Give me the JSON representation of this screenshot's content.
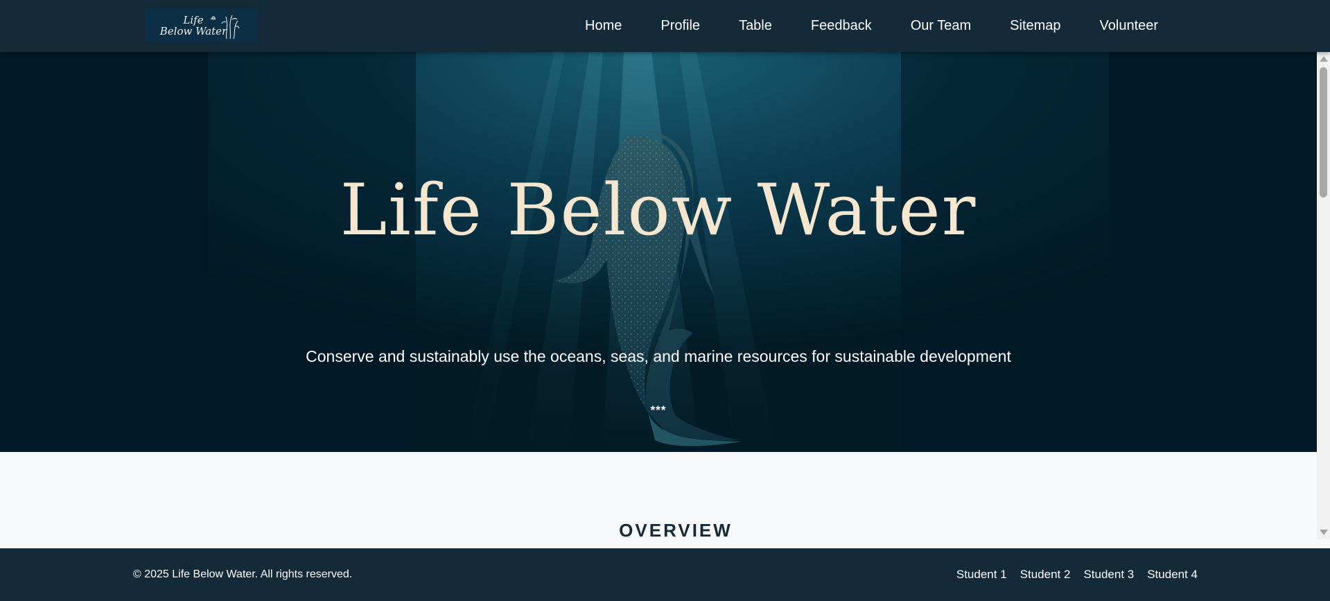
{
  "header": {
    "logo_text_line1": "Life",
    "logo_text_line2": "Below Water",
    "nav": [
      {
        "label": "Home"
      },
      {
        "label": "Profile"
      },
      {
        "label": "Table"
      },
      {
        "label": "Feedback"
      },
      {
        "label": "Our Team"
      },
      {
        "label": "Sitemap"
      },
      {
        "label": "Volunteer"
      }
    ]
  },
  "hero": {
    "title": "Life Below Water",
    "subtitle": "Conserve and sustainably use the oceans, seas, and marine resources for sustainable development",
    "divider": "***",
    "background": "whale-shark-underwater-image"
  },
  "main": {
    "section_heading": "OVERVIEW"
  },
  "footer": {
    "copyright": "© 2025 Life Below Water. All rights reserved.",
    "links": [
      {
        "label": "Student 1"
      },
      {
        "label": "Student 2"
      },
      {
        "label": "Student 3"
      },
      {
        "label": "Student 4"
      }
    ]
  },
  "colors": {
    "nav_bg": "#142a38",
    "footer_bg": "#142a38",
    "hero_title": "#f4e6cf",
    "heading": "#142a38",
    "page_bg": "#f6f8fa"
  }
}
